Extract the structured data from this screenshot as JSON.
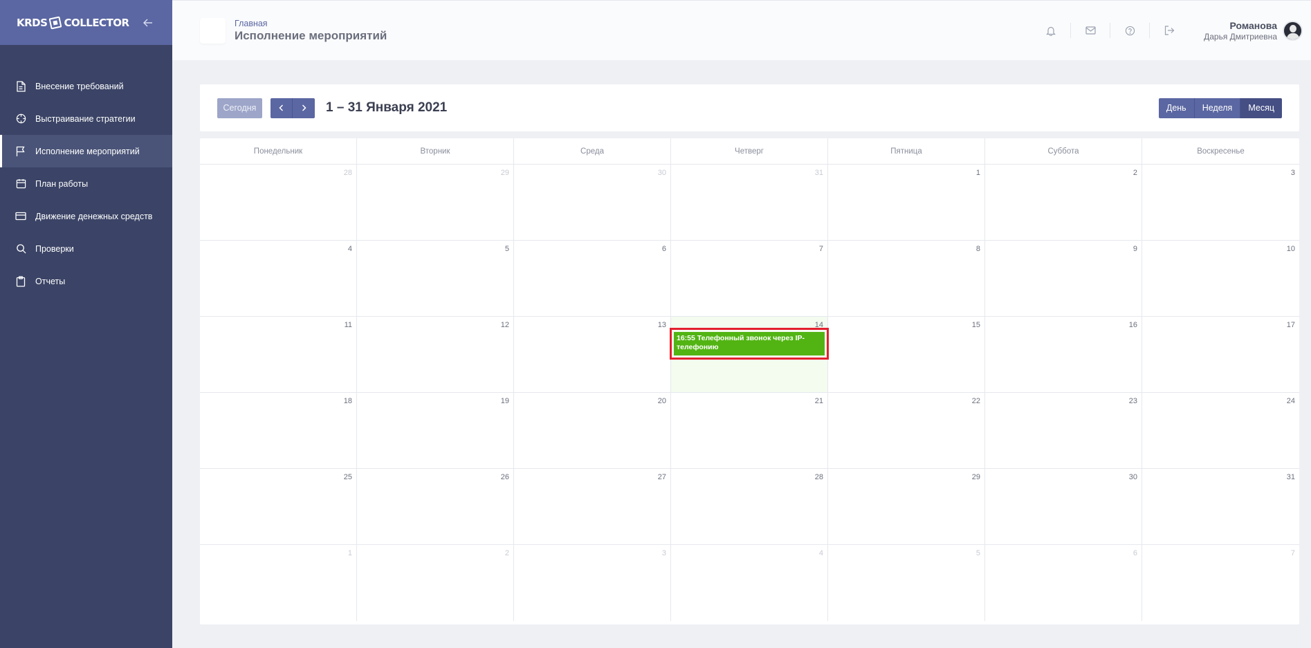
{
  "sidebar": {
    "logo_left": "KRDS",
    "logo_right": "COLLECTOR",
    "items": [
      {
        "label": "Внесение требований",
        "icon": "document-icon",
        "active": false
      },
      {
        "label": "Выстраивание стратегии",
        "icon": "crosshair-icon",
        "active": false
      },
      {
        "label": "Исполнение мероприятий",
        "icon": "flag-icon",
        "active": true
      },
      {
        "label": "План работы",
        "icon": "calendar-icon",
        "active": false
      },
      {
        "label": "Движение денежных средств",
        "icon": "credit-card-icon",
        "active": false
      },
      {
        "label": "Проверки",
        "icon": "search-icon",
        "active": false
      },
      {
        "label": "Отчеты",
        "icon": "clipboard-icon",
        "active": false
      }
    ]
  },
  "header": {
    "breadcrumb_home": "Главная",
    "title": "Исполнение мероприятий",
    "user_last_name": "Романова",
    "user_first_name": "Дарья Дмитриевна"
  },
  "toolbar": {
    "today_label": "Сегодня",
    "range_title": "1 – 31 Января 2021",
    "views": [
      "День",
      "Неделя",
      "Месяц"
    ],
    "active_view": "Месяц"
  },
  "calendar": {
    "weekdays": [
      "Понедельник",
      "Вторник",
      "Среда",
      "Четверг",
      "Пятница",
      "Суббота",
      "Воскресенье"
    ],
    "days": [
      28,
      29,
      30,
      31,
      1,
      2,
      3,
      4,
      5,
      6,
      7,
      8,
      9,
      10,
      11,
      12,
      13,
      14,
      15,
      16,
      17,
      18,
      19,
      20,
      21,
      22,
      23,
      24,
      25,
      26,
      27,
      28,
      29,
      30,
      31,
      1,
      2,
      3,
      4,
      5,
      6,
      7
    ],
    "event": {
      "day_index": 17,
      "text": "16:55 Телефонный звонок через IP-телефонию",
      "color": "#52b413"
    }
  },
  "colors": {
    "sidebar_bg": "#3b4466",
    "brand": "#5b67a2",
    "highlight": "#e3202e"
  }
}
